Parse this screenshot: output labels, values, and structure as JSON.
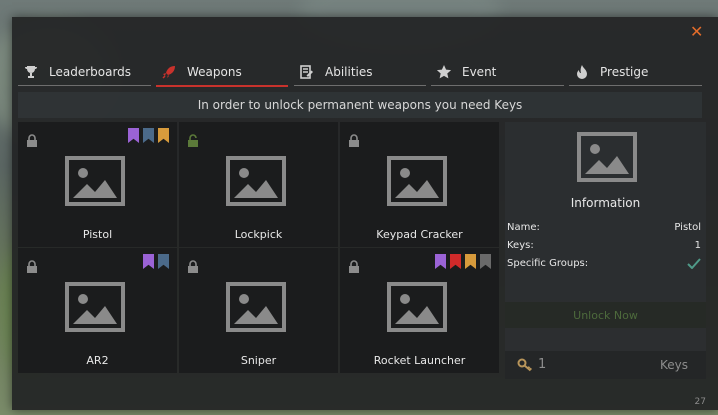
{
  "window": {
    "close_label": "✕",
    "corner_number": "27"
  },
  "tabs": [
    {
      "label": "Leaderboards",
      "icon": "trophy-icon",
      "active": false
    },
    {
      "label": "Weapons",
      "icon": "rocket-icon",
      "active": true
    },
    {
      "label": "Abilities",
      "icon": "ability-icon",
      "active": false
    },
    {
      "label": "Event",
      "icon": "star-icon",
      "active": false
    },
    {
      "label": "Prestige",
      "icon": "flame-icon",
      "active": false
    }
  ],
  "banner": "In order to unlock permanent weapons you need Keys",
  "weapons": [
    {
      "name": "Pistol",
      "locked": true,
      "tags": [
        "#9b63d6",
        "#4b6a8a",
        "#d79b3c"
      ]
    },
    {
      "name": "Lockpick",
      "locked": false,
      "tags": []
    },
    {
      "name": "Keypad Cracker",
      "locked": true,
      "tags": []
    },
    {
      "name": "AR2",
      "locked": true,
      "tags": [
        "#9b63d6",
        "#4b6a8a"
      ]
    },
    {
      "name": "Sniper",
      "locked": true,
      "tags": []
    },
    {
      "name": "Rocket Launcher",
      "locked": true,
      "tags": [
        "#9b63d6",
        "#d02a2a",
        "#d79b3c",
        "#6a6a6a"
      ]
    }
  ],
  "info": {
    "title": "Information",
    "name_label": "Name:",
    "name_value": "Pistol",
    "keys_label": "Keys:",
    "keys_value": "1",
    "groups_label": "Specific Groups:",
    "unlock_label": "Unlock Now",
    "keys_count": "1",
    "keys_text": "Keys"
  },
  "colors": {
    "accent": "#c8322c",
    "close": "#e36c2a",
    "check": "#4f9a88"
  }
}
